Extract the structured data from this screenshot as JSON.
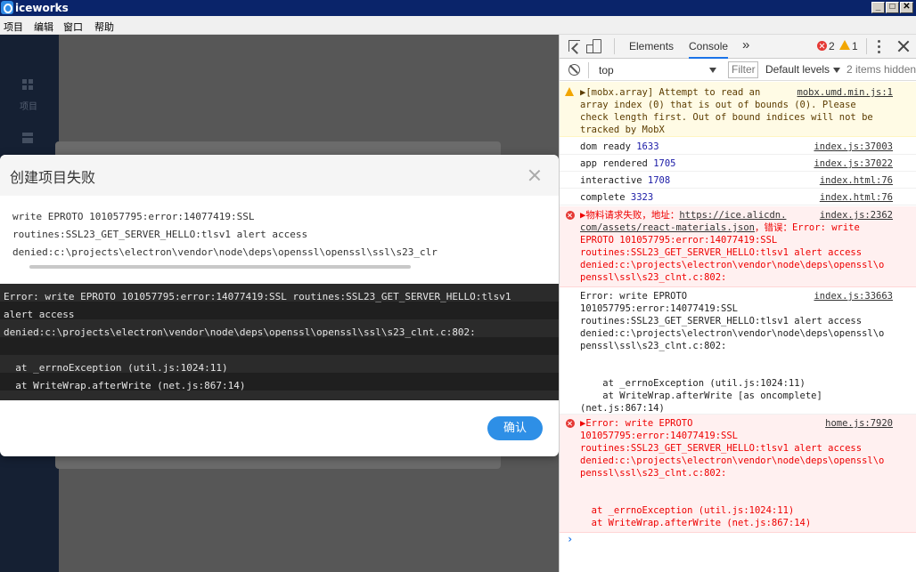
{
  "window": {
    "title": "iceworks",
    "controls": [
      "_",
      "□",
      "✕"
    ]
  },
  "menu": [
    "项目",
    "编辑",
    "窗口",
    "帮助"
  ],
  "app": {
    "sidebar": {
      "project_label": "项目"
    }
  },
  "dialog": {
    "title": "创建项目失败",
    "message_lines": [
      "write EPROTO 101057795:error:14077419:SSL",
      "routines:SSL23_GET_SERVER_HELLO:tlsv1 alert access",
      "denied:c:\\projects\\electron\\vendor\\node\\deps\\openssl\\openssl\\ssl\\s23_clr"
    ],
    "error_lines": [
      "Error: write EPROTO 101057795:error:14077419:SSL routines:SSL23_GET_SERVER_HELLO:tlsv1",
      "alert access",
      "denied:c:\\projects\\electron\\vendor\\node\\deps\\openssl\\openssl\\ssl\\s23_clnt.c:802:",
      "",
      "  at _errnoException (util.js:1024:11)",
      "  at WriteWrap.afterWrite (net.js:867:14)"
    ],
    "confirm_label": "确认"
  },
  "devtools": {
    "tabs": [
      "Elements",
      "Console"
    ],
    "active_tab": "Console",
    "more_tabs": "»",
    "error_count": "2",
    "warning_count": "1",
    "context": "top",
    "filter_placeholder": "Filter",
    "levels": "Default levels",
    "hidden_items": "2 items hidden",
    "messages": {
      "warn1": {
        "text": "▶[mobx.array] Attempt to read an\narray index (0) that is out of bounds (0). Please\ncheck length first. Out of bound indices will not be\ntracked by MobX",
        "source": "mobx.umd.min.js:1"
      },
      "log1": {
        "label": "dom ready",
        "value": "1633",
        "source": "index.js:37003"
      },
      "log2": {
        "label": "app rendered",
        "value": "1705",
        "source": "index.js:37022"
      },
      "log3": {
        "label": "interactive",
        "value": "1708",
        "source": "index.html:76"
      },
      "log4": {
        "label": "complete",
        "value": "3323",
        "source": "index.html:76"
      },
      "err1": {
        "prefix": "▶物料请求失败，地址：",
        "url_line1": "https://ice.alicdn.",
        "rest": "com/assets/react-materials.json",
        "tail": "，错误：Error: write\nEPROTO 101057795:error:14077419:SSL\nroutines:SSL23_GET_SERVER_HELLO:tlsv1 alert access\ndenied:c:\\projects\\electron\\vendor\\node\\deps\\openssl\\o\npenssl\\ssl\\s23_clnt.c:802:",
        "source": "index.js:2362"
      },
      "log5": {
        "text": "Error: write EPROTO\n101057795:error:14077419:SSL\nroutines:SSL23_GET_SERVER_HELLO:tlsv1 alert access\ndenied:c:\\projects\\electron\\vendor\\node\\deps\\openssl\\o\npenssl\\ssl\\s23_clnt.c:802:\n\n\n    at _errnoException (util.js:1024:11)\n    at WriteWrap.afterWrite [as oncomplete]\n(net.js:867:14)",
        "source": "index.js:33663"
      },
      "err2": {
        "text": "▶Error: write EPROTO\n101057795:error:14077419:SSL\nroutines:SSL23_GET_SERVER_HELLO:tlsv1 alert access\ndenied:c:\\projects\\electron\\vendor\\node\\deps\\openssl\\o\npenssl\\ssl\\s23_clnt.c:802:\n\n\n  at _errnoException (util.js:1024:11)\n  at WriteWrap.afterWrite (net.js:867:14)",
        "source": "home.js:7920"
      }
    },
    "prompt": "›"
  }
}
